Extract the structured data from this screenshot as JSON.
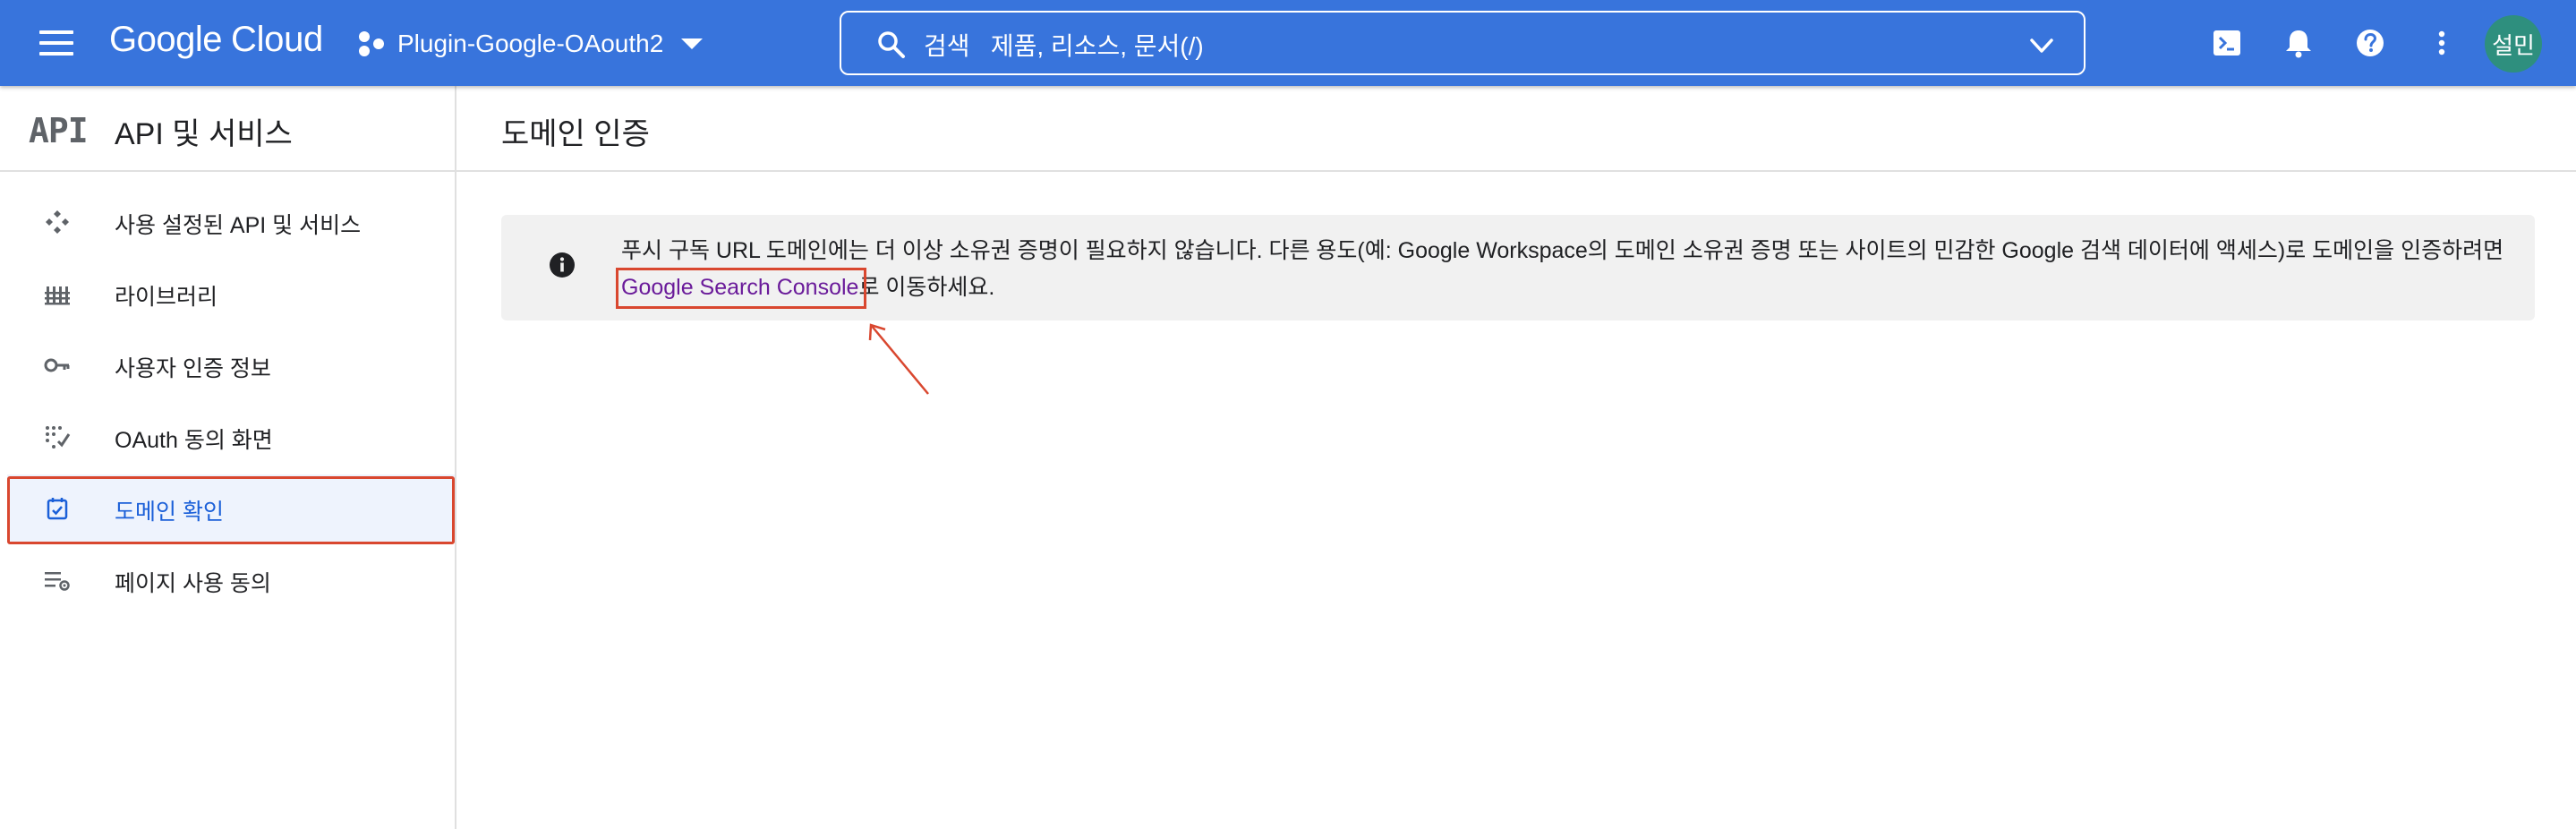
{
  "topbar": {
    "brand_google": "Google",
    "brand_cloud": "Cloud",
    "project_name": "Plugin-Google-OAouth2",
    "search_placeholder": "검색   제품, 리소스, 문서(/)",
    "avatar_initials": "설민",
    "icons": [
      "menu-icon",
      "project-icon",
      "search-icon",
      "chevron-down-icon",
      "terminal-icon",
      "bell-icon",
      "help-icon",
      "more-vert-icon"
    ],
    "bar_color": "#3874dc"
  },
  "sidebar": {
    "logo": "API",
    "title": "API 및 서비스",
    "items": [
      {
        "label": "사용 설정된 API 및 서비스",
        "icon": "api-diamond-icon"
      },
      {
        "label": "라이브러리",
        "icon": "library-icon"
      },
      {
        "label": "사용자 인증 정보",
        "icon": "key-icon"
      },
      {
        "label": "OAuth 동의 화면",
        "icon": "oauth-consent-icon"
      },
      {
        "label": "도메인 확인",
        "icon": "domain-check-icon",
        "active": true
      },
      {
        "label": "페이지 사용 동의",
        "icon": "page-consent-icon"
      }
    ],
    "active_color": "#1a5fd8",
    "highlight_color": "#d9472f"
  },
  "main": {
    "title": "도메인 인증",
    "notice": {
      "icon": "info-icon",
      "text_before": "푸시 구독 URL 도메인에는 더 이상 소유권 증명이 필요하지 않습니다. 다른 용도(예: Google Workspace의 도메인 소유권 증명 또는 사이트의 민감한 Google 검색 데이터에 액세스)로 도메인을 인증하려면 ",
      "link_text": "Google Search Console",
      "text_after": "로 이동하세요."
    }
  }
}
